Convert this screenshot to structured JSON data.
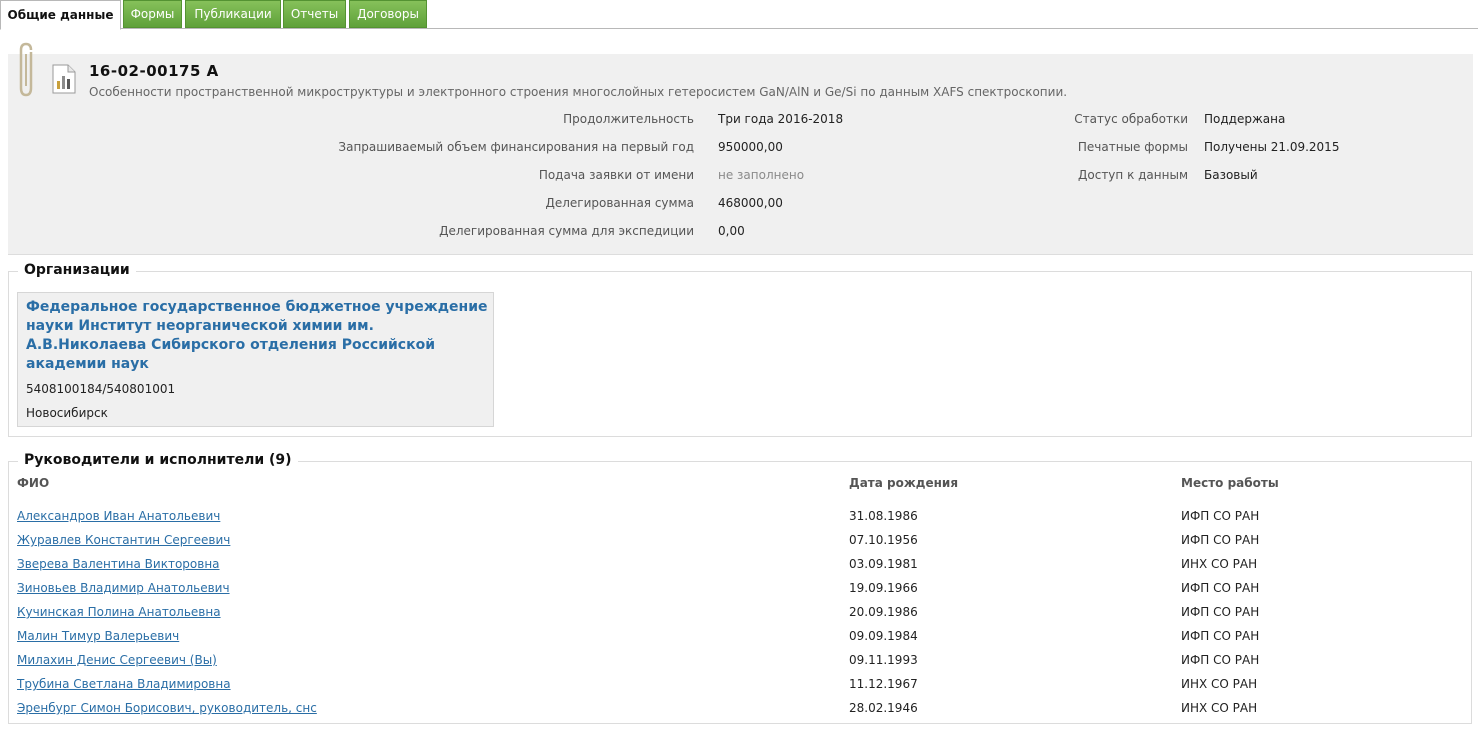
{
  "tabs": [
    {
      "label": "Общие данные"
    },
    {
      "label": "Формы"
    },
    {
      "label": "Публикации"
    },
    {
      "label": "Отчеты"
    },
    {
      "label": "Договоры"
    }
  ],
  "project": {
    "code": "16-02-00175 А",
    "title": "Особенности пространственной микроструктуры и электронного строения многослойных гетеросистем GaN/AlN и Ge/Si по данным XAFS спектроскопии.",
    "left_fields": [
      {
        "label": "Продолжительность",
        "value": "Три года 2016-2018"
      },
      {
        "label": "Запрашиваемый объем финансирования на первый год",
        "value": "950000,00"
      },
      {
        "label": "Подача заявки от имени",
        "value": "не заполнено"
      },
      {
        "label": "Делегированная сумма",
        "value": "468000,00"
      },
      {
        "label": "Делегированная сумма для экспедиции",
        "value": "0,00"
      }
    ],
    "right_fields": [
      {
        "label": "Статус обработки",
        "value": "Поддержана"
      },
      {
        "label": "Печатные формы",
        "value": "Получены 21.09.2015"
      },
      {
        "label": "Доступ к данным",
        "value": "Базовый"
      }
    ]
  },
  "organizations": {
    "legend": "Организации",
    "org": {
      "name": "Федеральное государственное бюджетное учреждение науки Институт неорганической химии им. А.В.Николаева Сибирского отделения Российской академии наук",
      "inn": "5408100184/540801001",
      "city": "Новосибирск"
    }
  },
  "staff": {
    "legend": "Руководители и исполнители (9)",
    "columns": {
      "name": "ФИО",
      "birth": "Дата рождения",
      "work": "Место работы"
    },
    "rows": [
      {
        "name": "Александров Иван Анатольевич",
        "birth": "31.08.1986",
        "work": "ИФП СО РАН"
      },
      {
        "name": "Журавлев Константин Сергеевич",
        "birth": "07.10.1956",
        "work": "ИФП СО РАН"
      },
      {
        "name": "Зверева Валентина Викторовна",
        "birth": "03.09.1981",
        "work": "ИНХ СО РАН"
      },
      {
        "name": "Зиновьев Владимир Анатольевич",
        "birth": "19.09.1966",
        "work": "ИФП СО РАН"
      },
      {
        "name": "Кучинская Полина Анатольевна",
        "birth": "20.09.1986",
        "work": "ИФП СО РАН"
      },
      {
        "name": "Малин Тимур Валерьевич",
        "birth": "09.09.1984",
        "work": "ИФП СО РАН"
      },
      {
        "name": "Милахин Денис Сергеевич (Вы)",
        "birth": "09.11.1993",
        "work": "ИФП СО РАН"
      },
      {
        "name": "Трубина Светлана Владимировна",
        "birth": "11.12.1967",
        "work": "ИНХ СО РАН"
      },
      {
        "name": "Эренбург Симон Борисович, руководитель, снс",
        "birth": "28.02.1946",
        "work": "ИНХ СО РАН"
      }
    ]
  },
  "colors": {
    "tab_green": "#6fb247",
    "link": "#2a6ea6",
    "panel_bg": "#f0f0f0"
  },
  "icons": {
    "clip": "paperclip-icon",
    "doc": "document-chart-icon"
  }
}
